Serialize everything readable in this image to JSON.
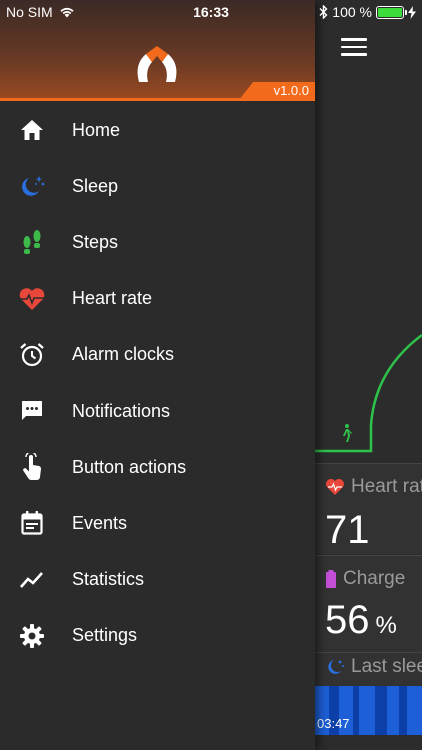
{
  "status_bar": {
    "carrier": "No SIM",
    "time": "16:33",
    "battery_percent": "100 %",
    "battery_level": 1.0
  },
  "drawer": {
    "version": "v1.0.0",
    "items": [
      {
        "label": "Home",
        "icon": "home-icon",
        "color": "#ffffff"
      },
      {
        "label": "Sleep",
        "icon": "moon-stars-icon",
        "color": "#2a6fe0"
      },
      {
        "label": "Steps",
        "icon": "footprints-icon",
        "color": "#3dbb4a"
      },
      {
        "label": "Heart rate",
        "icon": "heart-pulse-icon",
        "color": "#e8473a"
      },
      {
        "label": "Alarm clocks",
        "icon": "alarm-clock-icon",
        "color": "#ffffff"
      },
      {
        "label": "Notifications",
        "icon": "chat-bubble-icon",
        "color": "#ffffff"
      },
      {
        "label": "Button actions",
        "icon": "tap-hand-icon",
        "color": "#ffffff"
      },
      {
        "label": "Events",
        "icon": "calendar-icon",
        "color": "#ffffff"
      },
      {
        "label": "Statistics",
        "icon": "trend-line-icon",
        "color": "#ffffff"
      },
      {
        "label": "Settings",
        "icon": "gear-icon",
        "color": "#ffffff"
      }
    ]
  },
  "main": {
    "heart_rate": {
      "title": "Heart rat",
      "value": "71"
    },
    "charge": {
      "title": "Charge",
      "value": "56",
      "unit": "%"
    },
    "last_sleep": {
      "title": "Last slee",
      "time": "03:47"
    }
  },
  "colors": {
    "accent": "#f26a1b",
    "steps_green": "#2ec24a",
    "sleep_blue": "#1c5fd6",
    "heart_red": "#e8473a",
    "charge_purple": "#c24fd6"
  }
}
